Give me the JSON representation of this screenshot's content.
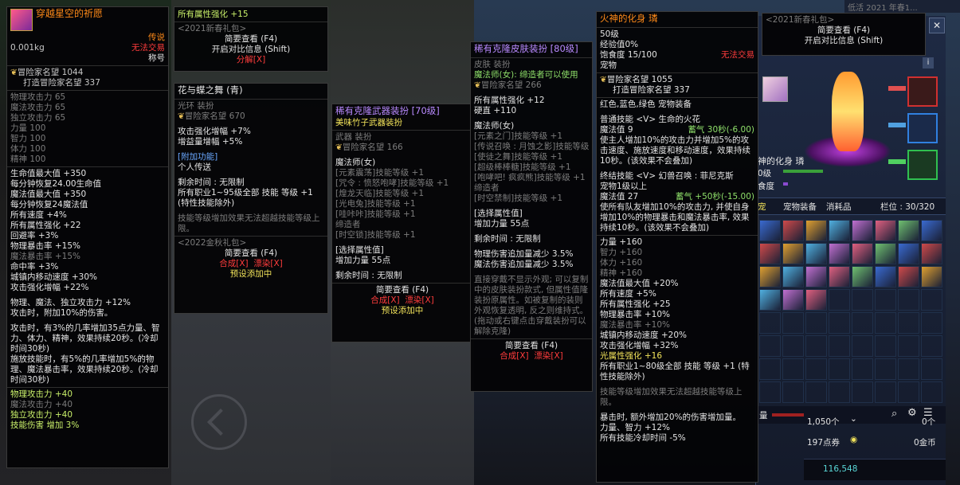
{
  "panel1": {
    "title": "穿越星空的祈愿",
    "rarity": "传说",
    "trade": "无法交易",
    "weight": "0.001kg",
    "slot": "称号",
    "fame_label": "冒险家名望",
    "fame": "1044",
    "fame_build": "打造冒险家名望",
    "fame_build_val": "337",
    "base_stats": [
      "物理攻击力 65",
      "魔法攻击力 65",
      "独立攻击力 65",
      "力量 100",
      "智力 100",
      "体力 100",
      "精神 100"
    ],
    "stats": [
      "生命值最大值 +350",
      "每分钟恢复24.00生命值",
      "魔法值最大值 +350",
      "每分钟恢复24魔法值",
      "所有速度 +4%",
      "所有属性强化 +22",
      "回避率 +3%",
      "物理暴击率 +15%"
    ],
    "stat_dim": "魔法暴击率 +15%",
    "stats2": [
      "命中率 +3%",
      "城镇内移动速度 +30%",
      "攻击强化增幅 +22%"
    ],
    "desc1": "物理、魔法、独立攻击力 +12%",
    "desc2": "攻击时，附加10%的伤害。",
    "desc3": "攻击时，有3%的几率增加35点力量、智力、体力、精神，效果持续20秒。(冷却时间30秒)",
    "desc4": "施放技能时，有5%的几率增加5%的物理、魔法暴击率，效果持续20秒。(冷却时间30秒)",
    "bonus_title": "物理攻击力 +40",
    "bonus_dim": "魔法攻击力 +40",
    "bonus": [
      "独立攻击力 +40",
      "技能伤害 增加 3%"
    ]
  },
  "panel2": {
    "stat": "所有属性强化",
    "stat_val": "+15",
    "pkg": "<2021新春礼包>",
    "view": "简要查看 (F4)",
    "compare": "开启对比信息 (Shift)",
    "decompose": "分解[X]"
  },
  "panel3": {
    "title": "花与蝶之舞 (青)",
    "type": "光环 装扮",
    "fame": "冒险家名望 670",
    "s1": "攻击强化增幅 +7%",
    "s2": "增益量增幅 +5%",
    "extra_title": "[附加功能]",
    "extra": "个人传送",
    "time": "剩余时间 : 无限制",
    "skill": "所有职业1~95级全部 技能 等级 +1 (特性技能除外)",
    "skill_note": "技能等级增加效果无法超越技能等级上限。",
    "pkg": "<2022金秋礼包>",
    "view": "简要查看 (F4)",
    "synth": "合成[X]",
    "dye": "漂染[X]",
    "preset": "预设添加中"
  },
  "panel4": {
    "title": "稀有克隆武器装扮 [70级]",
    "name": "美味竹子武器装扮",
    "type": "武器 装扮",
    "fame": "冒险家名望 166",
    "job": "魔法师(女)",
    "skills": [
      "[元素震荡]技能等级 +1",
      "[咒令 : 愤怒咆哮]技能等级 +1",
      "[煌龙天临]技能等级 +1",
      "[光电兔]技能等级 +1",
      "[哇咔咔]技能等级 +1"
    ],
    "sub": "缔造者",
    "sub_skill": "[时空锁]技能等级 +1",
    "choose": "[选择属性值]",
    "choose_val": "增加力量 55点",
    "time": "剩余时间 : 无限制",
    "view": "简要查看 (F4)",
    "synth": "合成[X]",
    "dye": "漂染[X]",
    "preset": "预设添加中"
  },
  "panel5": {
    "title": "稀有克隆皮肤装扮 [80级]",
    "type": "皮肤 装扮",
    "job_note": "魔法师(女): 缔造者可以使用",
    "fame": "冒险家名望 266",
    "s1": "所有属性强化 +12",
    "s2": "硬直 +110",
    "job": "魔法师(女)",
    "skills": [
      "[元素之门]技能等级 +1",
      "[传说召唤 : 月蚀之影]技能等级 +1",
      "[使徒之舞]技能等级 +1",
      "[超级棒棒糖]技能等级 +1",
      "[咆哮吧! 疯疯熊]技能等级 +1"
    ],
    "sub": "缔造者",
    "sub_skill": "[时空禁制]技能等级 +1",
    "choose": "[选择属性值]",
    "choose_val": "增加力量 55点",
    "time": "剩余时间 : 无限制",
    "r1": "物理伤害追加量减少 3.5%",
    "r2": "魔法伤害追加量减少 3.5%",
    "note": "直接穿戴不显示外观; 可以复制中的皮肤装扮款式, 但属性值隆装扮原属性。如被复制的装则外观恢复透明, 反之则维持式。(拖动或右键点击穿戴装扮可以解除克隆)",
    "view": "简要查看 (F4)",
    "synth": "合成[X]",
    "dye": "漂染[X]"
  },
  "panel6": {
    "title": "火神的化身 璘",
    "level": "50级",
    "exp": "经验值0%",
    "food": "饱食度 15/100",
    "trade": "无法交易",
    "kind": "宠物",
    "fame": "冒险家名望 1055",
    "fame_build": "打造冒险家名望 337",
    "colors": "红色,蓝色,绿色 宠物装备",
    "skill1": "普通技能 <V> 生命的火花",
    "mp1": "魔法值 9",
    "cd1": "蓄气 30秒(-6.00)",
    "desc1": "使主人增加10%的攻击力并增加5%的攻击速度、施放速度和移动速度，效果持续10秒。(该效果不会叠加)",
    "skill2": "终结技能 <V> 幻兽召唤 : 菲尼克斯",
    "skill2b": "宠物1级以上",
    "mp2": "魔法值 27",
    "cd2": "蓄气 +50秒(-15.00)",
    "desc2": "使所有队友增加10%的攻击力, 并使自身增加10%的物理暴击和魔法暴击率, 效果持续10秒。(该效果不会叠加)",
    "str": "力量 +160",
    "dim": [
      "智力 +160",
      "体力 +160",
      "精神 +160"
    ],
    "stats": [
      "魔法值最大值 +20%",
      "所有速度 +5%",
      "所有属性强化 +25",
      "物理暴击率 +10%"
    ],
    "stat_dim": "魔法暴击率 +10%",
    "stats2": [
      "城镇内移动速度 +20%",
      "攻击强化增幅 +32%"
    ],
    "light": "光属性强化 +16",
    "skill_all": "所有职业1~80级全部 技能 等级 +1 (特性技能除外)",
    "skill_note": "技能等级增加效果无法超越技能等级上限。",
    "crit": "暴击时, 额外增加20%的伤害增加量。",
    "crit2": "力量、智力 +12%",
    "cool": "所有技能冷却时间 -5%"
  },
  "panel7": {
    "pkg": "<2021新春礼包>",
    "view": "简要查看 (F4)",
    "compare": "开启对比信息 (Shift)",
    "top_text": "低活 2021 年春1..."
  },
  "pet_window": {
    "pet_name": "神的化身 璘",
    "lv": "0级",
    "food": "食度",
    "tab1": "宠",
    "tab2": "宠物装备",
    "tab3": "消耗品",
    "slots": "栏位 : 30/320",
    "bottom_count": "1,050个",
    "zero_count": "0个",
    "coupon": "197点券",
    "gold": "0金币",
    "money": "116,548",
    "mp_label": "量"
  }
}
